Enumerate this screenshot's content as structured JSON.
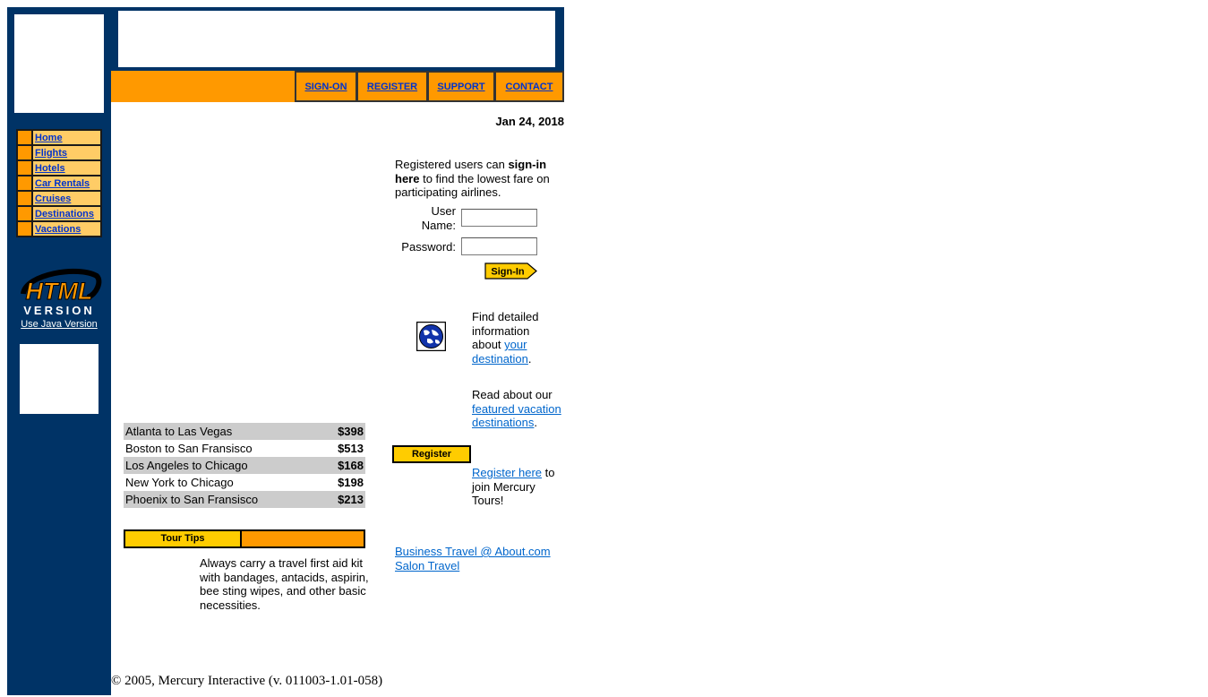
{
  "sidebar": {
    "items": [
      {
        "label": "Home"
      },
      {
        "label": "Flights"
      },
      {
        "label": "Hotels"
      },
      {
        "label": "Car Rentals"
      },
      {
        "label": "Cruises"
      },
      {
        "label": "Destinations"
      },
      {
        "label": "Vacations"
      }
    ],
    "badge_line1": "HTML",
    "badge_line2": "VERSION",
    "java_link": "Use Java Version"
  },
  "nav": {
    "signon": "SIGN-ON",
    "register": "REGISTER",
    "support": "SUPPORT",
    "contact": "CONTACT"
  },
  "date": "Jan 24, 2018",
  "fares": [
    {
      "route": "Atlanta to Las Vegas",
      "price": "$398"
    },
    {
      "route": "Boston to San Fransisco",
      "price": "$513"
    },
    {
      "route": "Los Angeles to Chicago",
      "price": "$168"
    },
    {
      "route": "New York to Chicago",
      "price": "$198"
    },
    {
      "route": "Phoenix to San Fransisco",
      "price": "$213"
    }
  ],
  "tour_tips": {
    "label": "Tour Tips",
    "text": "Always carry a travel first aid kit with bandages, antacids, aspirin, bee sting wipes, and other basic necessities."
  },
  "signin": {
    "intro_pre": "Registered users can ",
    "intro_bold": "sign-in here",
    "intro_post": " to find the lowest fare on participating airlines.",
    "user_label": "User Name:",
    "password_label": "Password:",
    "username_value": "",
    "password_value": "",
    "button_label": "Sign-In"
  },
  "destination": {
    "pre": "Find detailed information about ",
    "link": "your destination",
    "post": "."
  },
  "featured": {
    "pre": "Read about our ",
    "link": "featured vacation destinations",
    "post": "."
  },
  "register": {
    "button_label": "Register",
    "link": "Register here",
    "post": " to join Mercury Tours!"
  },
  "links": {
    "business": "Business Travel @ About.com",
    "salon": "Salon Travel"
  },
  "footer": "© 2005, Mercury Interactive (v. 011003-1.01-058)",
  "colors": {
    "navy": "#003366",
    "orange": "#ff9900",
    "light_orange": "#ffcc66",
    "yellow": "#ffcc00",
    "link": "#0066cc"
  }
}
